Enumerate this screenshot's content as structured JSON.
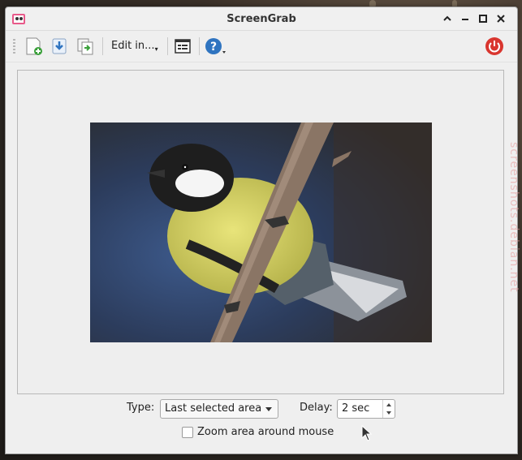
{
  "window": {
    "title": "ScreenGrab"
  },
  "toolbar": {
    "new_icon": "new-screenshot-icon",
    "save_icon": "save-icon",
    "copy_icon": "copy-to-clipboard-icon",
    "edit_label": "Edit in...",
    "options_icon": "options-icon",
    "help_icon": "help-icon",
    "quit_icon": "power-icon"
  },
  "preview": {
    "image_subject": "bird-photo"
  },
  "controls": {
    "type_label": "Type:",
    "type_value": "Last selected area",
    "delay_label": "Delay:",
    "delay_value": "2 sec",
    "zoom_label": "Zoom area around mouse",
    "zoom_checked": false
  },
  "watermark": "screenshots.debian.net",
  "colors": {
    "help": "#2f74c0",
    "quit": "#d9362f",
    "add_green": "#3aa03a"
  }
}
